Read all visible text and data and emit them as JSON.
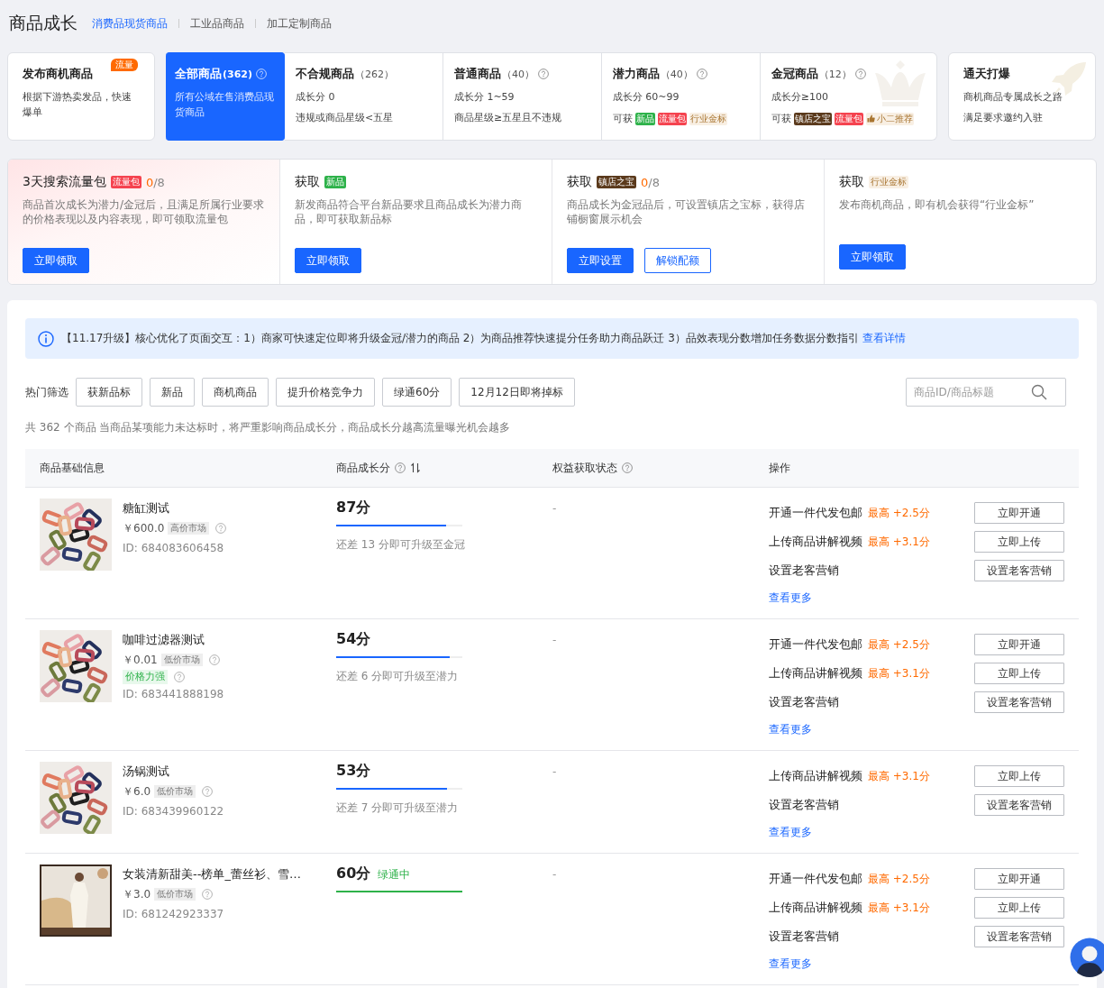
{
  "header": {
    "title": "商品成长",
    "tabs": [
      {
        "label": "消费品现货商品",
        "selected": true
      },
      {
        "label": "工业品商品",
        "selected": false
      },
      {
        "label": "加工定制商品",
        "selected": false
      }
    ]
  },
  "stages": [
    {
      "kind": "publish",
      "title": "发布商机商品",
      "badge": "流量",
      "selected": false,
      "help": false,
      "lines": [
        "根据下游热卖发品，快速爆单"
      ]
    },
    {
      "kind": "tier",
      "title": "全部商品",
      "count": "(362)",
      "selected": true,
      "help": true,
      "lines": [
        "所有公域在售消费品现货商品"
      ]
    },
    {
      "kind": "tier",
      "title": "不合规商品",
      "count": "（262）",
      "selected": false,
      "help": false,
      "lines": [
        "成长分 0",
        "违规或商品星级<五星"
      ]
    },
    {
      "kind": "tier",
      "title": "普通商品",
      "count": "（40）",
      "selected": false,
      "help": true,
      "lines": [
        "成长分 1~59",
        "商品星级≥五星且不违规"
      ]
    },
    {
      "kind": "tier",
      "title": "潜力商品",
      "count": "（40）",
      "selected": false,
      "help": true,
      "lines": [
        "成长分 60~99"
      ],
      "perks": {
        "label": "可获",
        "tags": [
          {
            "label": "新品",
            "kind": "solid",
            "color": "#2eb24a"
          },
          {
            "label": "流量包",
            "kind": "solid",
            "color": "#f5434f"
          },
          {
            "label": "行业金标",
            "kind": "soft",
            "color": "#f8efe3"
          }
        ]
      }
    },
    {
      "kind": "crown",
      "title": "金冠商品",
      "count": "（12）",
      "selected": false,
      "help": true,
      "lines": [
        "成长分≥100"
      ],
      "perks": {
        "label": "可获",
        "tags": [
          {
            "label": "镇店之宝",
            "kind": "solid",
            "color": "#5b3a1c"
          },
          {
            "label": "流量包",
            "kind": "solid",
            "color": "#f5434f"
          },
          {
            "label": "小二推荐",
            "kind": "endorse",
            "color": "#f8efe3"
          }
        ]
      }
    },
    {
      "kind": "invite",
      "title": "通天打爆",
      "selected": false,
      "help": false,
      "lines": [
        "商机商品专属成长之路",
        "满足要求邀约入驻"
      ]
    }
  ],
  "benefits": [
    {
      "title": "3天搜索流量包",
      "highlight": true,
      "tag": {
        "label": "流量包",
        "kind": "solid",
        "color": "#f5434f"
      },
      "done": "0",
      "total": "/8",
      "desc": "商品首次成长为潜力/金冠后，且满足所属行业要求的价格表现以及内容表现，即可领取流量包",
      "buttons": [
        {
          "label": "立即领取",
          "kind": "primary"
        }
      ]
    },
    {
      "title": "获取",
      "highlight": false,
      "tag": {
        "label": "新品",
        "kind": "solid",
        "color": "#2eb24a"
      },
      "desc": "新发商品符合平台新品要求且商品成长为潜力商品，即可获取新品标",
      "buttons": [
        {
          "label": "立即领取",
          "kind": "primary"
        }
      ]
    },
    {
      "title": "获取",
      "highlight": false,
      "tag": {
        "label": "镇店之宝",
        "kind": "solid",
        "color": "#5b3a1c"
      },
      "done": "0",
      "total": "/8",
      "desc": "商品成长为金冠品后，可设置镇店之宝标，获得店铺橱窗展示机会",
      "buttons": [
        {
          "label": "立即设置",
          "kind": "primary"
        },
        {
          "label": "解锁配额",
          "kind": "outline"
        }
      ]
    },
    {
      "title": "获取",
      "highlight": false,
      "tag": {
        "label": "行业金标",
        "kind": "soft",
        "color": "#f8efe3"
      },
      "desc": "发布商机商品，即有机会获得“行业金标”",
      "buttons": [
        {
          "label": "立即领取",
          "kind": "primary"
        }
      ]
    }
  ],
  "notice": {
    "text": "【11.17升级】核心优化了页面交互：1）商家可快速定位即将升级金冠/潜力的商品 2）为商品推荐快速提分任务助力商品跃迁 3）品效表现分数增加任务数据分数指引",
    "link": "查看详情"
  },
  "filters": {
    "label": "热门筛选",
    "chips": [
      "获新品标",
      "新品",
      "商机商品",
      "提升价格竞争力",
      "绿通60分",
      "12月12日即将掉标"
    ]
  },
  "search": {
    "placeholder": "商品ID/商品标题"
  },
  "summary": "共 362 个商品 当商品某项能力未达标时，将严重影响商品成长分，商品成长分越高流量曝光机会越多",
  "table": {
    "columns": [
      {
        "label": "商品基础信息",
        "help": false,
        "sortable": false
      },
      {
        "label": "商品成长分",
        "help": true,
        "sortable": true
      },
      {
        "label": "权益获取状态",
        "help": true,
        "sortable": false
      },
      {
        "label": "操作",
        "help": false,
        "sortable": false
      }
    ],
    "rows": [
      {
        "image": {
          "kind": "picture"
        },
        "name": "糖缸测试",
        "price": "￥600.0",
        "market": "高价市场",
        "id": "ID: 684083606458",
        "score": "87分",
        "green_channel": false,
        "level": 0.87,
        "hint": "还差 13 分即可升级至金冠",
        "benefit_state": "-",
        "actions": [
          {
            "label": "开通一件代发包邮",
            "bonus": "最高 +2.5分",
            "button": "立即开通"
          },
          {
            "label": "上传商品讲解视频",
            "bonus": "最高 +3.1分",
            "button": "立即上传"
          },
          {
            "label": "设置老客营销",
            "button": "设置老客营销"
          }
        ],
        "more": "查看更多"
      },
      {
        "image": {
          "kind": "picture"
        },
        "name": "咖啡过滤器测试",
        "price": "￥0.01",
        "market": "低价市场",
        "price_power": "价格力强",
        "id": "ID: 683441888198",
        "score": "54分",
        "green_channel": false,
        "level": 0.9,
        "hint": "还差 6 分即可升级至潜力",
        "benefit_state": "-",
        "actions": [
          {
            "label": "开通一件代发包邮",
            "bonus": "最高 +2.5分",
            "button": "立即开通"
          },
          {
            "label": "上传商品讲解视频",
            "bonus": "最高 +3.1分",
            "button": "立即上传"
          },
          {
            "label": "设置老客营销",
            "button": "设置老客营销"
          }
        ],
        "more": "查看更多"
      },
      {
        "image": {
          "kind": "picture"
        },
        "name": "汤锅测试",
        "price": "￥6.0",
        "market": "低价市场",
        "id": "ID: 683439960122",
        "score": "53分",
        "green_channel": false,
        "level": 0.88,
        "hint": "还差 7 分即可升级至潜力",
        "benefit_state": "-",
        "actions": [
          {
            "label": "上传商品讲解视频",
            "bonus": "最高 +3.1分",
            "button": "立即上传"
          },
          {
            "label": "设置老客营销",
            "button": "设置老客营销"
          }
        ],
        "more": "查看更多"
      },
      {
        "image": {
          "kind": "picture"
        },
        "name": "女装清新甜美--榜单_蕾丝衫、雪…",
        "price": "￥3.0",
        "market": "低价市场",
        "id": "ID: 681242923337",
        "score": "60分",
        "green_channel": true,
        "status": "绿通中",
        "level": 1,
        "benefit_state": "-",
        "actions": [
          {
            "label": "开通一件代发包邮",
            "bonus": "最高 +2.5分",
            "button": "立即开通"
          },
          {
            "label": "上传商品讲解视频",
            "bonus": "最高 +3.1分",
            "button": "立即上传"
          },
          {
            "label": "设置老客营销",
            "button": "设置老客营销"
          }
        ],
        "more": "查看更多"
      }
    ]
  }
}
